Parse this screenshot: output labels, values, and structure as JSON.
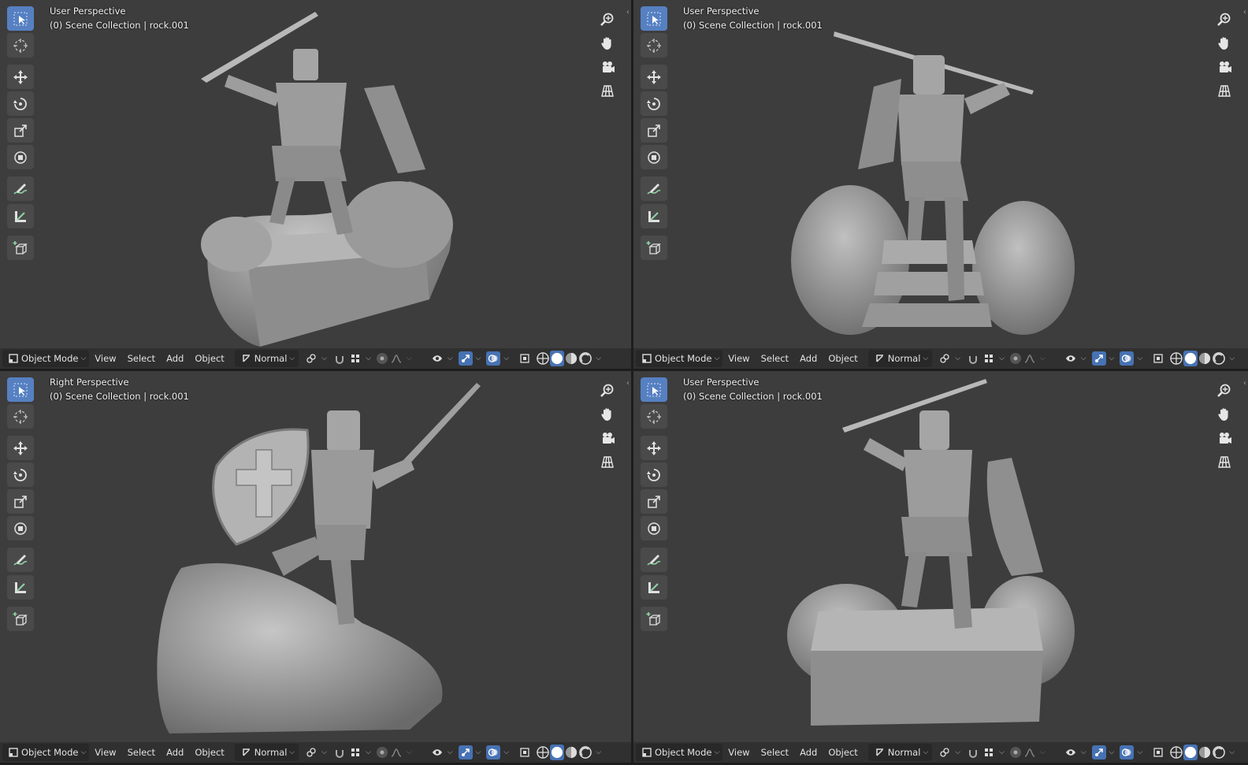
{
  "viewports": [
    {
      "id": "top-left",
      "perspective": "User Perspective",
      "collection": "(0) Scene Collection | rock.001"
    },
    {
      "id": "top-right",
      "perspective": "User Perspective",
      "collection": "(0) Scene Collection | rock.001"
    },
    {
      "id": "bottom-left",
      "perspective": "Right Perspective",
      "collection": "(0) Scene Collection | rock.001"
    },
    {
      "id": "bottom-right",
      "perspective": "User Perspective",
      "collection": "(0) Scene Collection | rock.001"
    }
  ],
  "header": {
    "mode": "Object Mode",
    "menus": [
      "View",
      "Select",
      "Add",
      "Object"
    ],
    "orientation": "Normal"
  },
  "tools": [
    "select-box-icon",
    "cursor-icon",
    "move-icon",
    "rotate-icon",
    "scale-icon",
    "transform-icon",
    "annotate-icon",
    "measure-icon",
    "add-cube-icon"
  ],
  "nav_gizmo": [
    "zoom-icon",
    "pan-hand-icon",
    "camera-icon",
    "perspective-grid-icon"
  ],
  "colors": {
    "viewport_bg": "#3d3d3d",
    "header_bg": "#303030",
    "active_tool": "#5680c2",
    "active_toggle": "#4772b3",
    "model": "#a8a8a8"
  }
}
